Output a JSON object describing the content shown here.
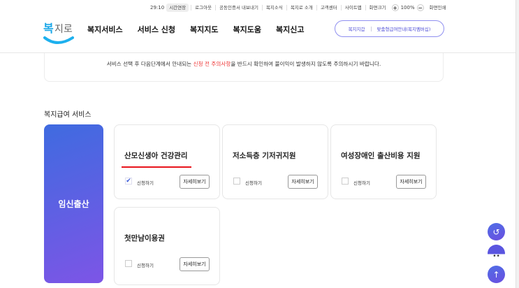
{
  "util": {
    "timer": "29:10",
    "extend": "시간연장",
    "links": [
      "로그아웃",
      "공동인증서 내보내기",
      "복지소식",
      "복지로 소개",
      "고객센터",
      "사이트맵",
      "화면크기"
    ],
    "zoom": "100%",
    "print": "화면인쇄"
  },
  "logo": "복지로",
  "nav": [
    "복지서비스",
    "서비스 신청",
    "복지지도",
    "복지도움",
    "복지신고"
  ],
  "pill": {
    "left": "복지지갑",
    "right": "맞춤형급여안내(복지멤버십)"
  },
  "notice": {
    "before": "서비스 선택 후 다음단계에서 안내되는 ",
    "highlight": "신청 전 주의사항",
    "after": "을 반드시 확인하여 불이익이 발생하지 않도록 주의하시기 바랍니다."
  },
  "section_title": "복지급여 서비스",
  "category": "임신출산",
  "cards": [
    {
      "title": "산모신생아 건강관리",
      "apply": "신청하기",
      "detail": "자세히보기",
      "checked": true
    },
    {
      "title": "저소득층 기저귀지원",
      "apply": "신청하기",
      "detail": "자세히보기",
      "checked": false
    },
    {
      "title": "여성장애인 출산비용 지원",
      "apply": "신청하기",
      "detail": "자세히보기",
      "checked": false
    },
    {
      "title": "첫만남이용권",
      "apply": "신청하기",
      "detail": "자세히보기",
      "checked": false
    }
  ]
}
